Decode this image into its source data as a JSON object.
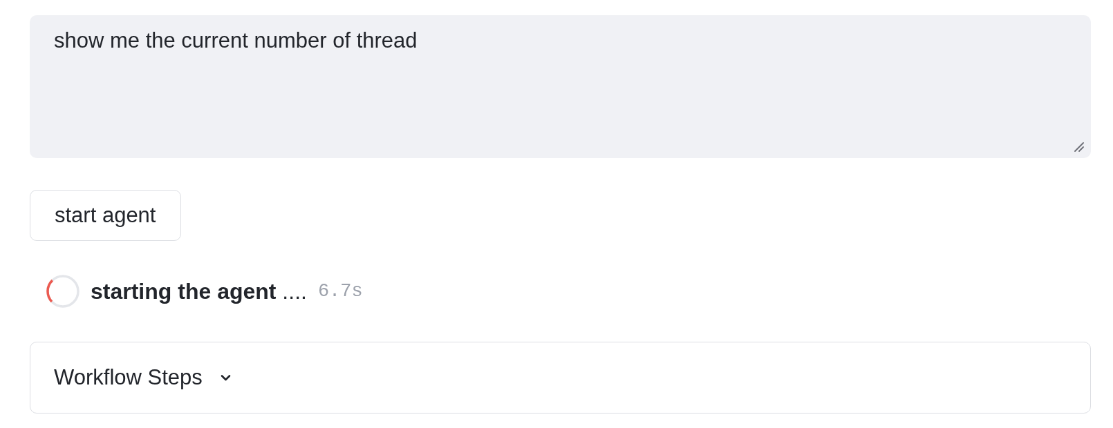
{
  "prompt": {
    "value": "show me the current number of thread"
  },
  "start_button": {
    "label": "start agent"
  },
  "status": {
    "in_progress": true,
    "message": "**starting the agent** ....",
    "elapsed": "6.7s"
  },
  "workflow": {
    "title": "Workflow Steps",
    "expanded": false
  }
}
